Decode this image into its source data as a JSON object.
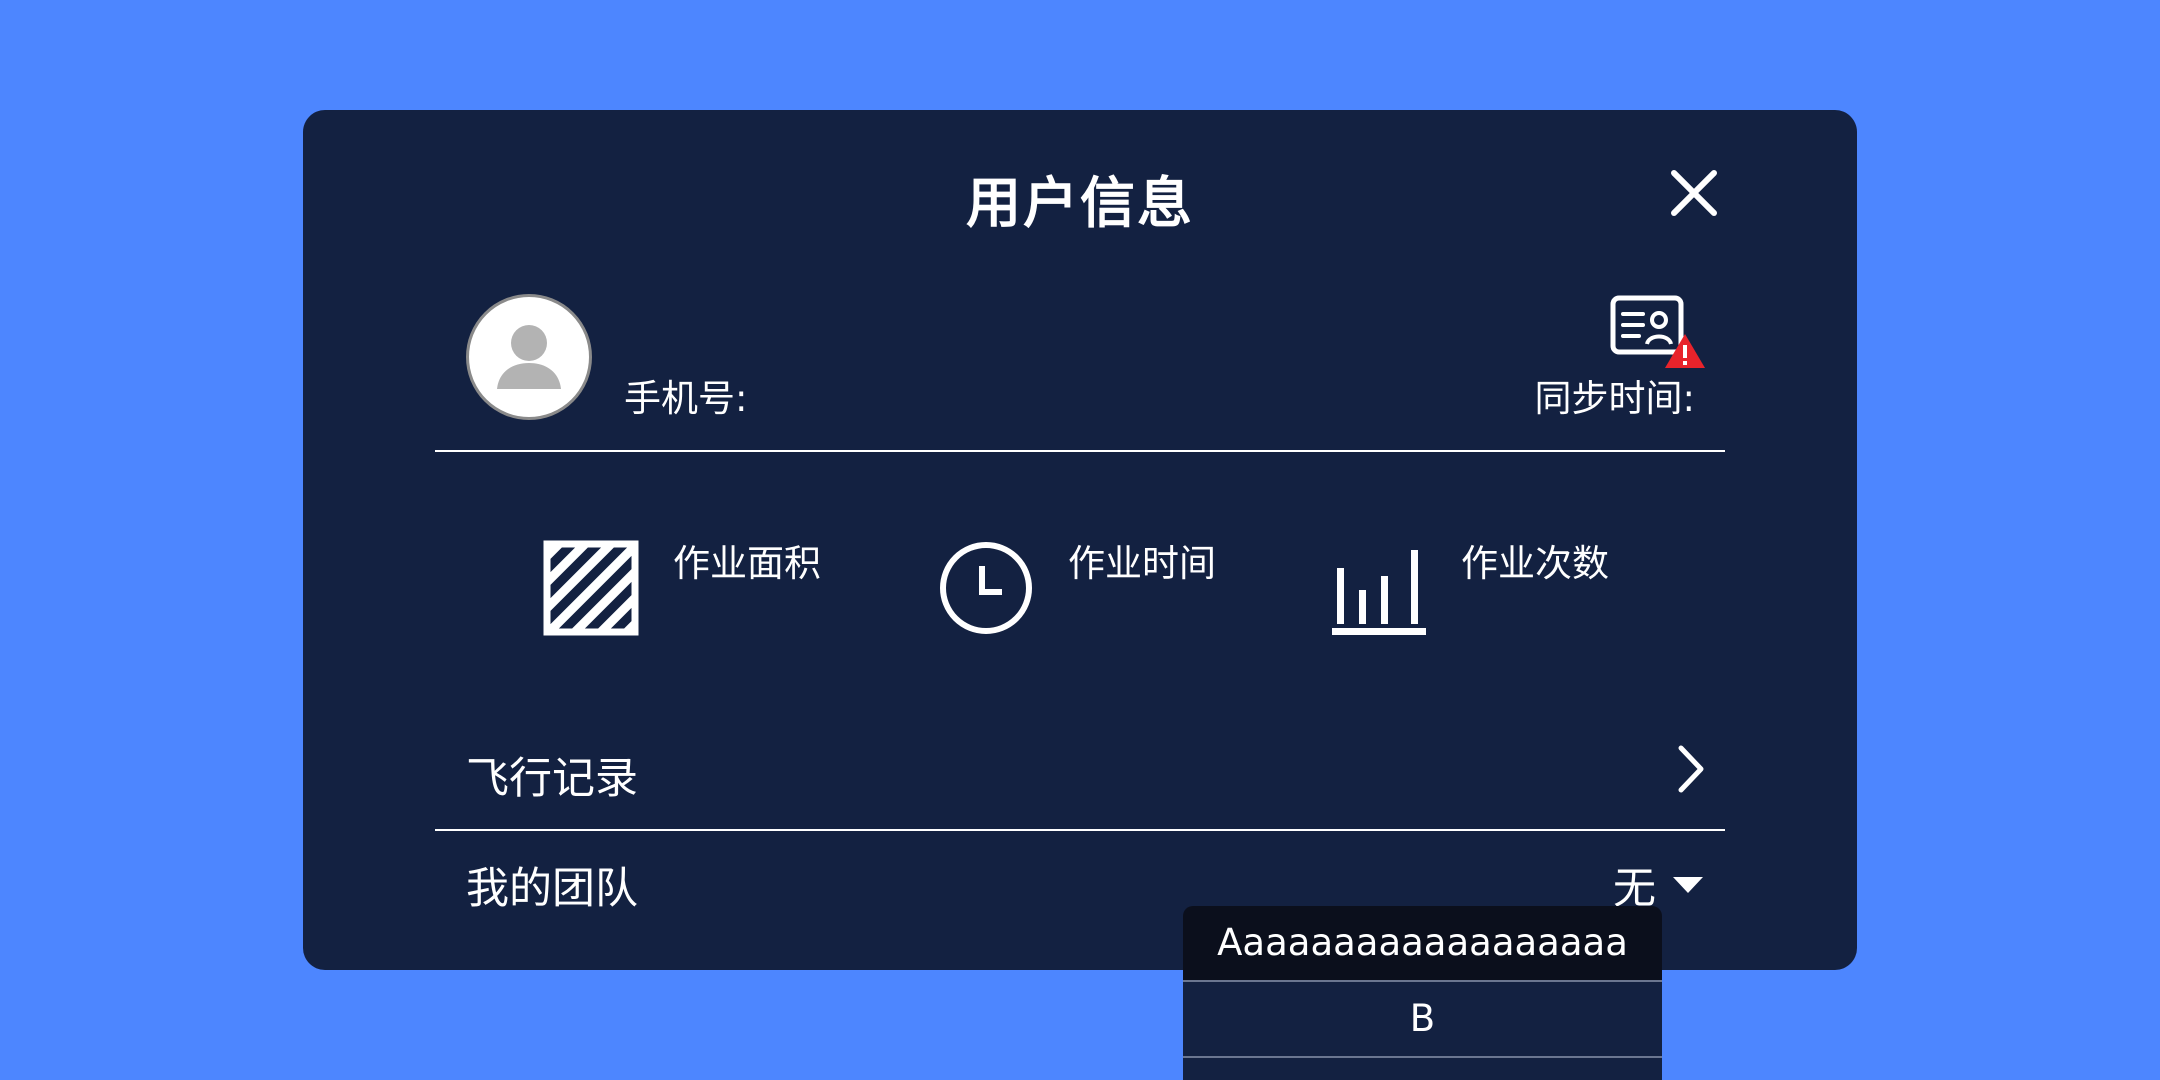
{
  "dialog": {
    "title": "用户信息"
  },
  "profile": {
    "phone_label": "手机号:",
    "sync_label": "同步时间:"
  },
  "stats": [
    {
      "label": "作业面积",
      "icon": "hatched-square-icon"
    },
    {
      "label": "作业时间",
      "icon": "clock-icon"
    },
    {
      "label": "作业次数",
      "icon": "bar-chart-icon"
    }
  ],
  "rows": {
    "flight_record": "飞行记录",
    "my_team": "我的团队",
    "team_value": "无"
  },
  "dropdown": {
    "options": [
      "Aaaaaaaaaaaaaaaaaa",
      "B"
    ],
    "selected_index": 0
  },
  "colors": {
    "background": "#4d86ff",
    "dialog": "#132141",
    "dropdown_selected": "#0b0f1c",
    "warning": "#e8232b"
  }
}
